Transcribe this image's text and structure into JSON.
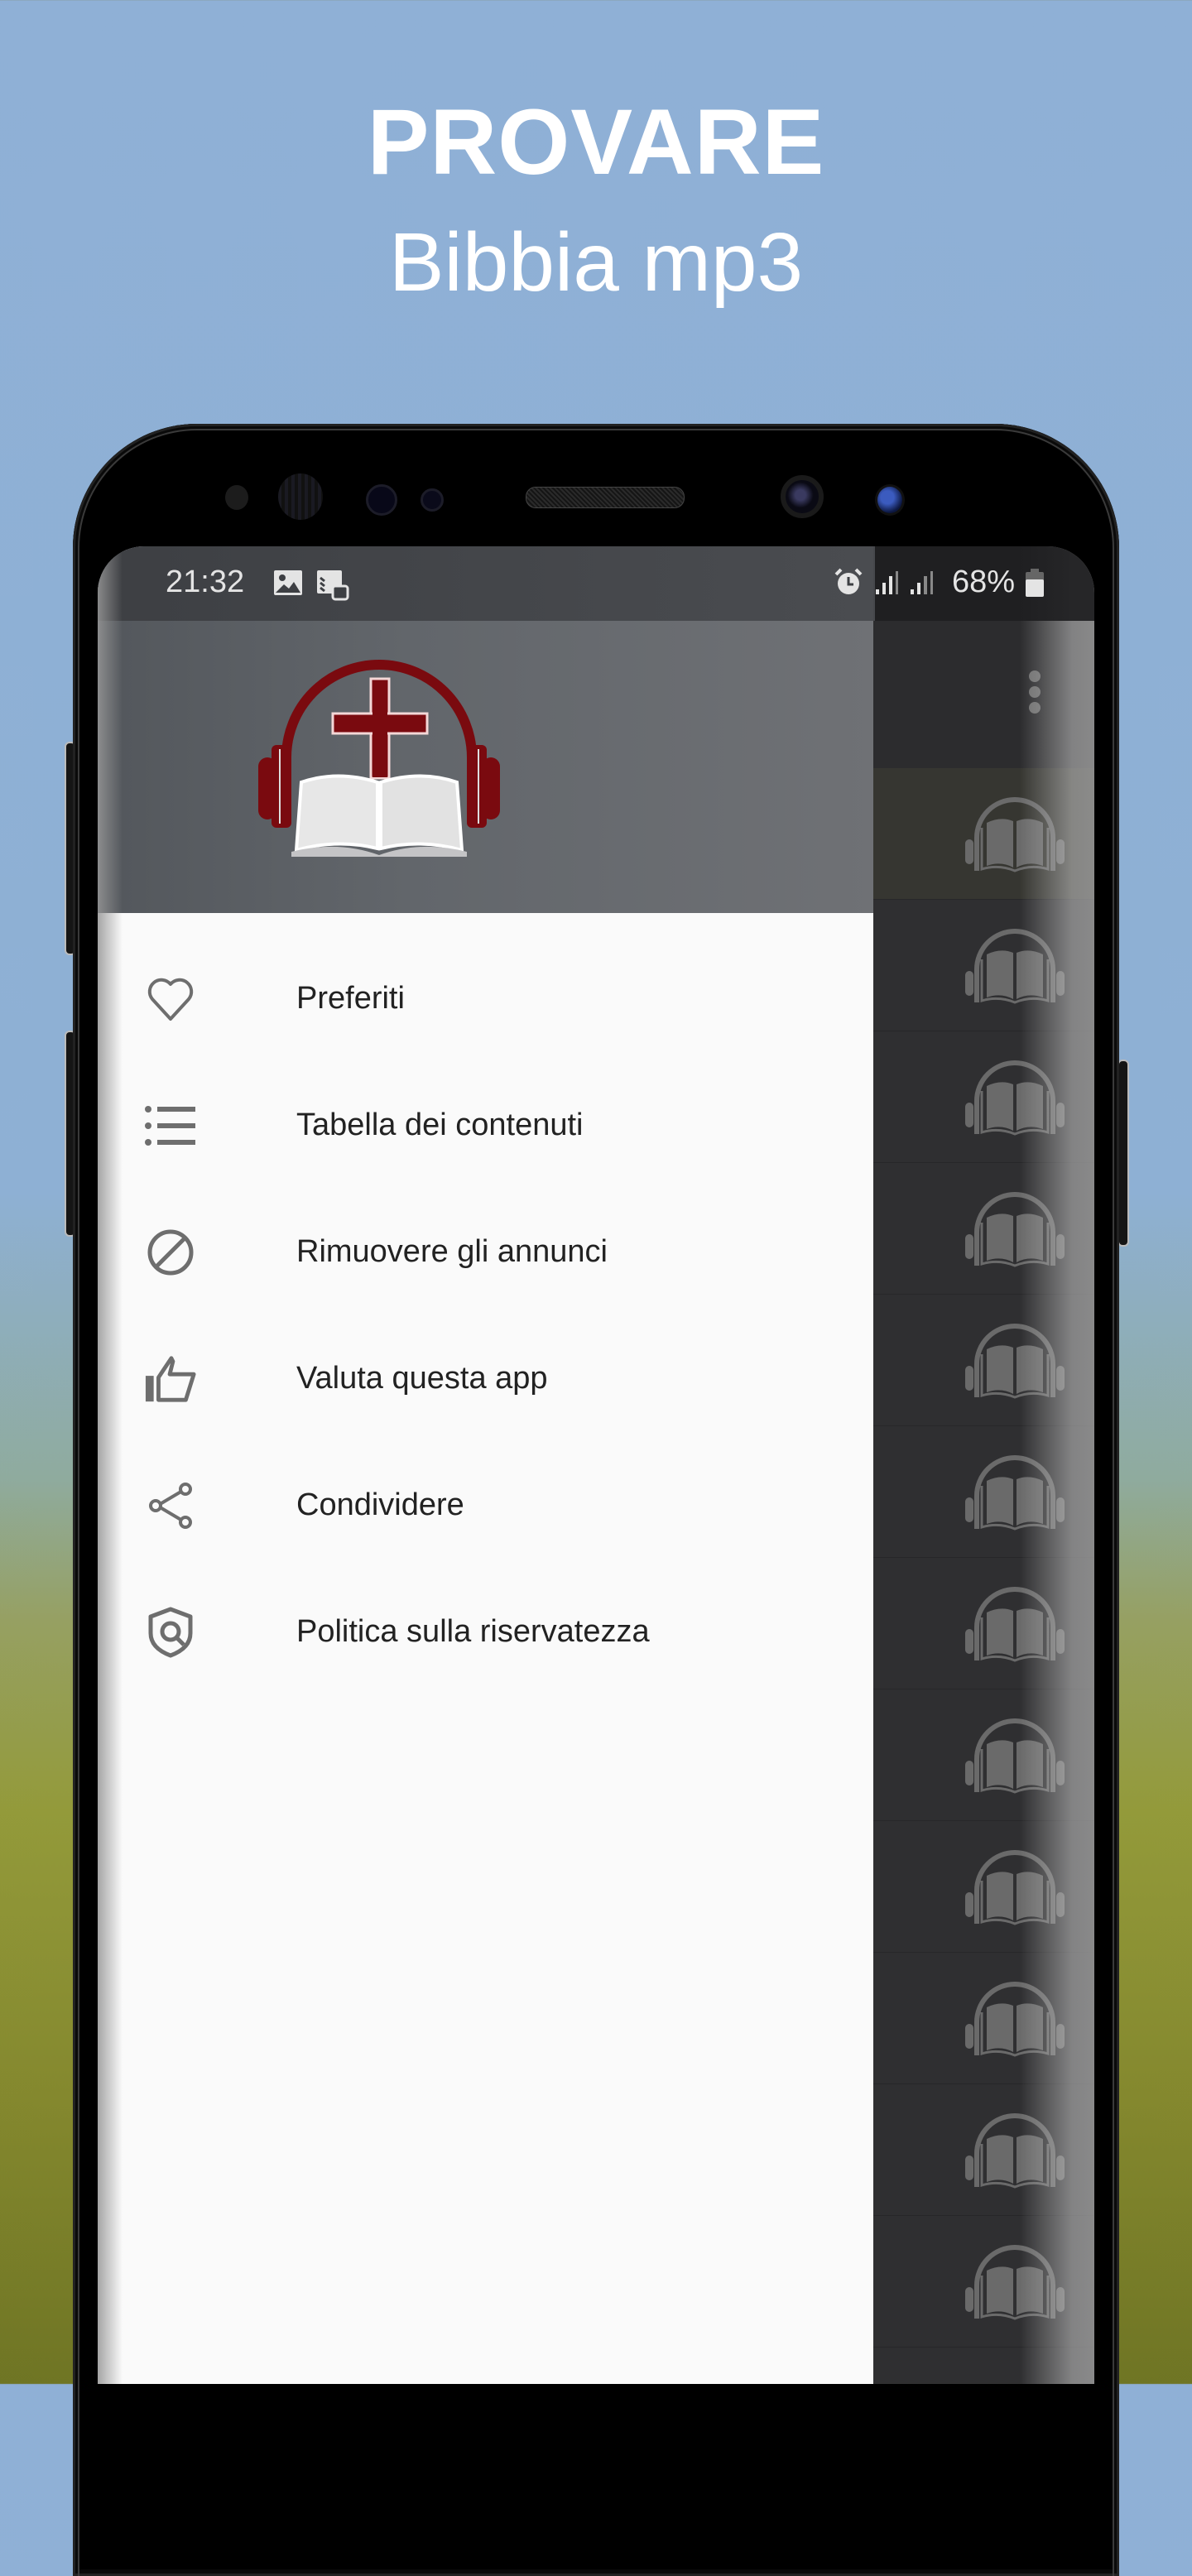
{
  "promo": {
    "title": "PROVARE",
    "subtitle": "Bibbia mp3"
  },
  "status_bar": {
    "time": "21:32",
    "left_icons": [
      "image-icon",
      "tasks-icon"
    ],
    "right_icons": [
      "alarm-icon",
      "signal-icon",
      "signal-icon"
    ],
    "battery_percent": "68%"
  },
  "app_bar": {
    "overflow_icon": "more-vert-icon"
  },
  "drawer": {
    "header_logo": "headphones-bible-cross-logo",
    "items": [
      {
        "label": "Preferiti",
        "icon": "heart-icon"
      },
      {
        "label": "Tabella dei contenuti",
        "icon": "list-icon"
      },
      {
        "label": "Rimuovere gli annunci",
        "icon": "block-icon"
      },
      {
        "label": "Valuta questa app",
        "icon": "thumbs-up-icon"
      },
      {
        "label": "Condividere",
        "icon": "share-icon"
      },
      {
        "label": "Politica sulla riservatezza",
        "icon": "privacy-shield-icon"
      }
    ]
  },
  "list": {
    "row_icon": "audiobook-icon",
    "row_count": 12,
    "active_row": 0
  },
  "colors": {
    "logo_red": "#7a0a0f",
    "drawer_bg": "#fafafa",
    "list_bg": "#2f2f31",
    "icon_gray": "#6e6e6e"
  }
}
